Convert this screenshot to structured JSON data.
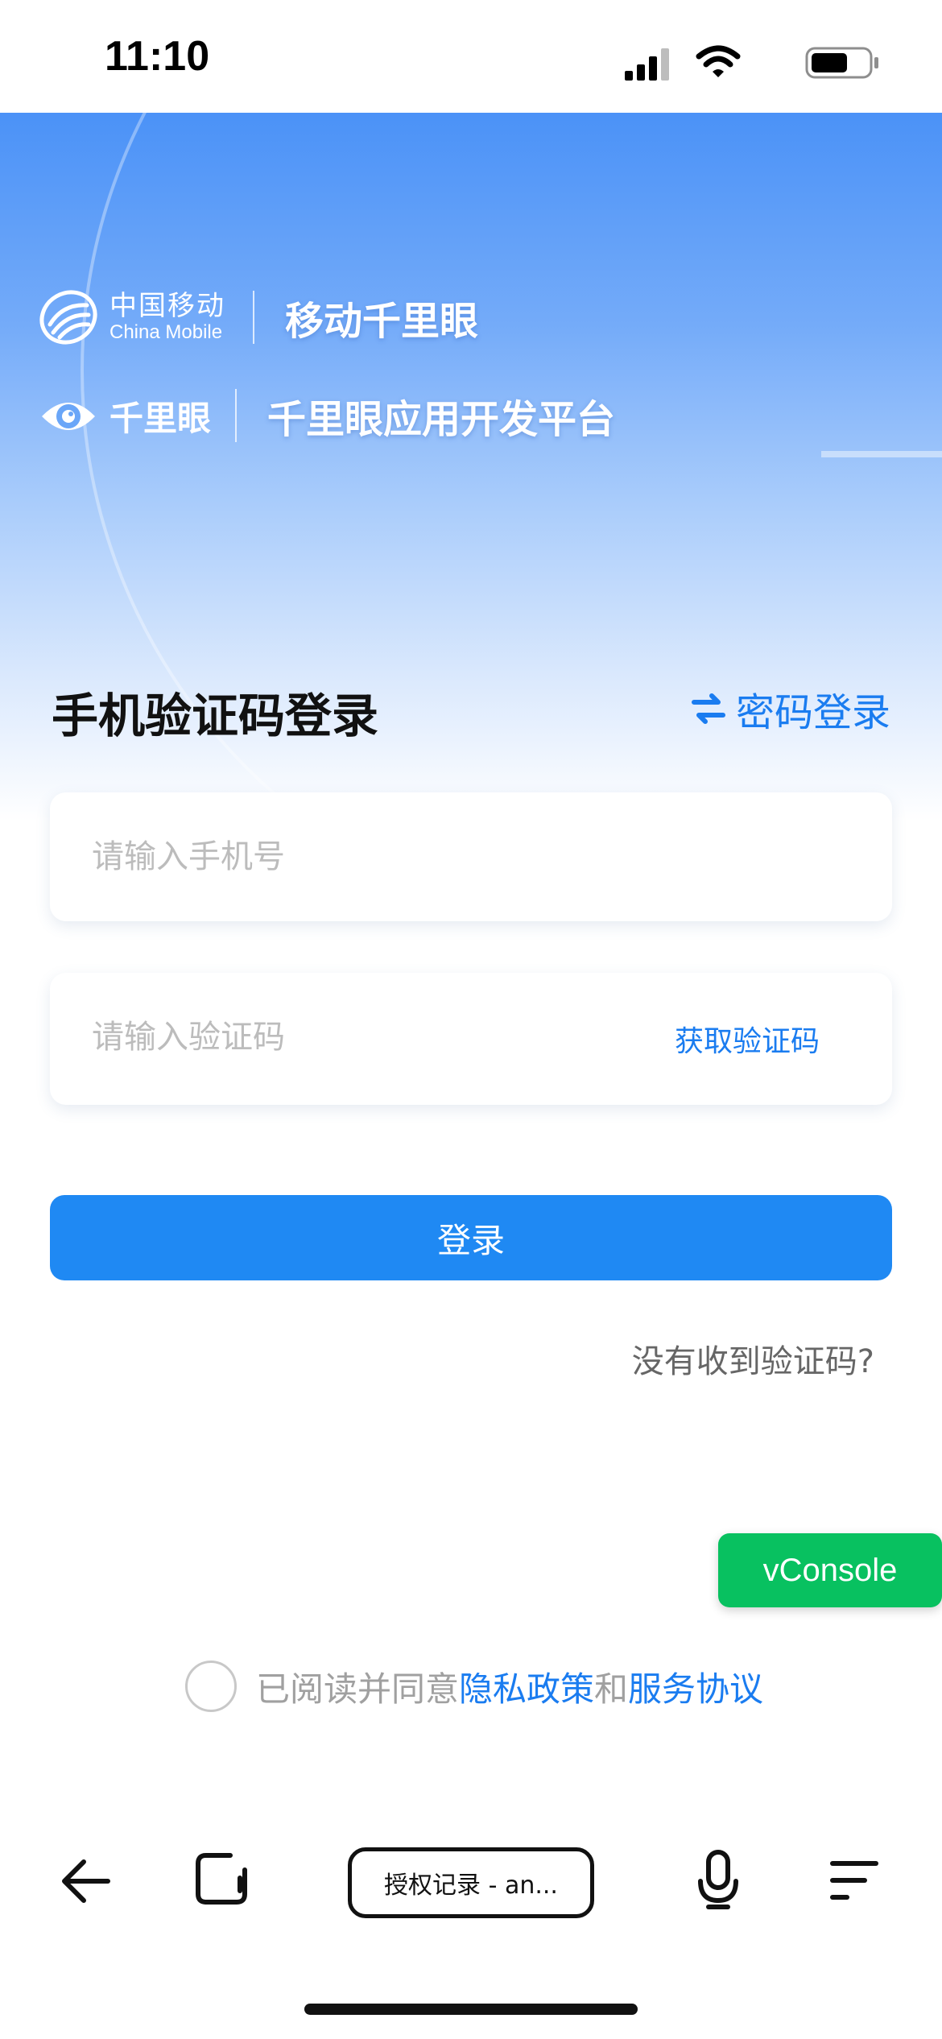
{
  "status_bar": {
    "time": "11:10"
  },
  "brand": {
    "china_mobile_cn": "中国移动",
    "china_mobile_en": "China Mobile",
    "app_name": "移动千里眼",
    "qly_logo_text": "千里眼",
    "platform_name": "千里眼应用开发平台"
  },
  "login": {
    "title": "手机验证码登录",
    "switch_label": "密码登录",
    "phone_placeholder": "请输入手机号",
    "code_placeholder": "请输入验证码",
    "get_code_label": "获取验证码",
    "submit_label": "登录",
    "no_code_label": "没有收到验证码?"
  },
  "vconsole": {
    "label": "vConsole"
  },
  "agreement": {
    "prefix": "已阅读并同意",
    "privacy_label": "隐私政策",
    "conjunction": "和",
    "service_label": "服务协议"
  },
  "toolbar": {
    "page_title": "授权记录 - an..."
  },
  "colors": {
    "accent": "#1f89f3",
    "link": "#1a7cf0",
    "vconsole": "#08c160"
  }
}
